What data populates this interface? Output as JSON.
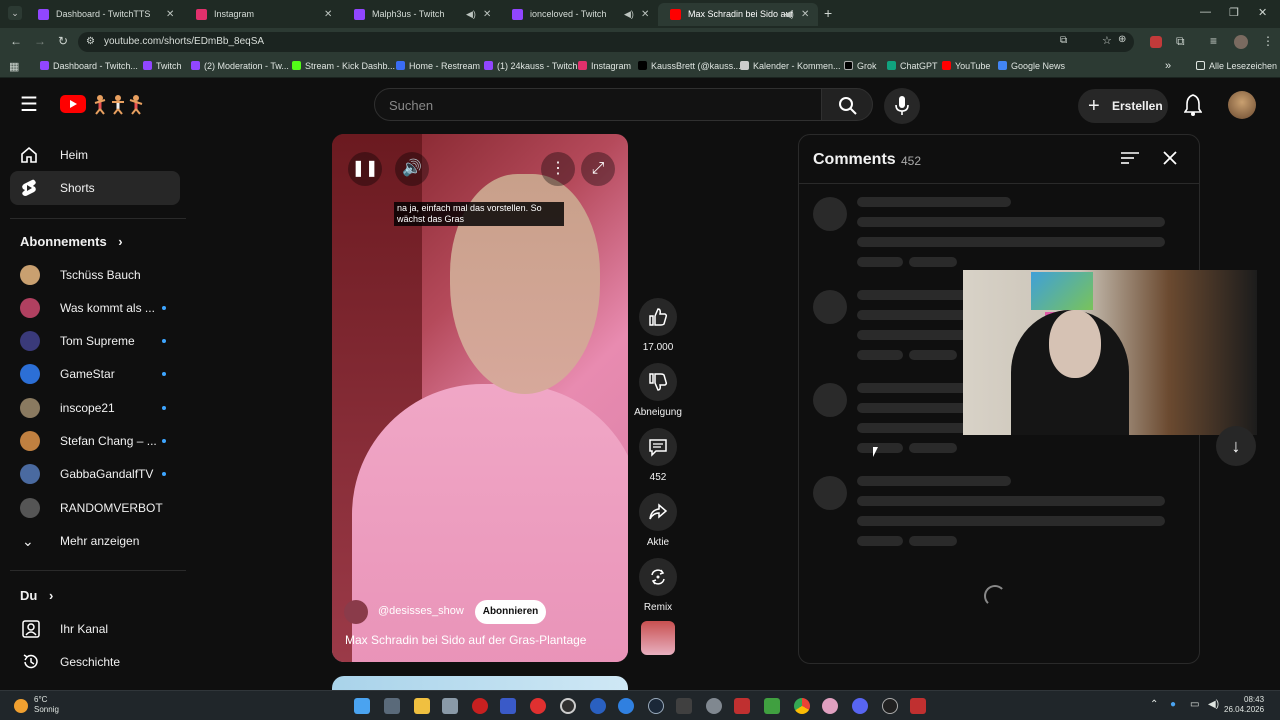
{
  "browser": {
    "tabs": [
      {
        "label": "Dashboard - TwitchTTS",
        "color": "#9146ff"
      },
      {
        "label": "Instagram",
        "color": "#e1306c"
      },
      {
        "label": "Malph3us - Twitch",
        "color": "#9146ff"
      },
      {
        "label": "ionceloved - Twitch",
        "color": "#9146ff"
      },
      {
        "label": "Max Schradin bei Sido auf",
        "color": "#ff0000"
      }
    ],
    "url": "youtube.com/shorts/EDmBb_8eqSA",
    "bookmarks": [
      {
        "label": "Dashboard - Twitch...",
        "color": "#9146ff"
      },
      {
        "label": "Twitch",
        "color": "#9146ff"
      },
      {
        "label": "(2) Moderation - Tw...",
        "color": "#9146ff"
      },
      {
        "label": "Stream - Kick Dashb...",
        "color": "#53fc18"
      },
      {
        "label": "Home - Restream",
        "color": "#3a6cf4"
      },
      {
        "label": "(1) 24kauss - Twitch",
        "color": "#9146ff"
      },
      {
        "label": "Instagram",
        "color": "#e1306c"
      },
      {
        "label": "KaussBrett (@kauss...",
        "color": "#000000"
      },
      {
        "label": "Kalender - Kommen...",
        "color": "#cccccc"
      },
      {
        "label": "Grok",
        "color": "#000000"
      },
      {
        "label": "ChatGPT",
        "color": "#10a37f"
      },
      {
        "label": "YouTube",
        "color": "#ff0000"
      },
      {
        "label": "Google News",
        "color": "#4285f4"
      }
    ],
    "all_bookmarks": "Alle Lesezeichen"
  },
  "header": {
    "search_placeholder": "Suchen",
    "create_label": "Erstellen"
  },
  "sidebar": {
    "home": "Heim",
    "shorts": "Shorts",
    "subscriptions_heading": "Abonnements",
    "subscriptions": [
      {
        "name": "Tschüss Bauch",
        "color": "#c9a070",
        "new": false
      },
      {
        "name": "Was kommt als ...",
        "color": "#b04060",
        "new": true
      },
      {
        "name": "Tom Supreme",
        "color": "#3a3a7a",
        "new": true
      },
      {
        "name": "GameStar",
        "color": "#2c6fd6",
        "new": true
      },
      {
        "name": "inscope21",
        "color": "#8a7a60",
        "new": true
      },
      {
        "name": "Stefan Chang – ...",
        "color": "#c08040",
        "new": true
      },
      {
        "name": "GabbaGandalfTV",
        "color": "#4a6aa0",
        "new": true
      },
      {
        "name": "RANDOMVERBOT",
        "color": "#555555",
        "new": false
      }
    ],
    "show_more": "Mehr anzeigen",
    "you_heading": "Du",
    "your_channel": "Ihr Kanal",
    "history": "Geschichte"
  },
  "video": {
    "caption": "na ja, einfach mal das vorstellen. So wächst das Gras",
    "channel": "@desisses_show",
    "subscribe": "Abonnieren",
    "title": "Max Schradin bei Sido auf der Gras-Plantage"
  },
  "actions": {
    "likes": "17.000",
    "dislike": "Abneigung",
    "comments": "452",
    "share": "Aktie",
    "remix": "Remix"
  },
  "comments": {
    "title": "Comments",
    "count": "452"
  },
  "taskbar": {
    "temp": "6°C",
    "weather": "Sonnig",
    "time": "08:43",
    "date": "26.04.2026"
  }
}
